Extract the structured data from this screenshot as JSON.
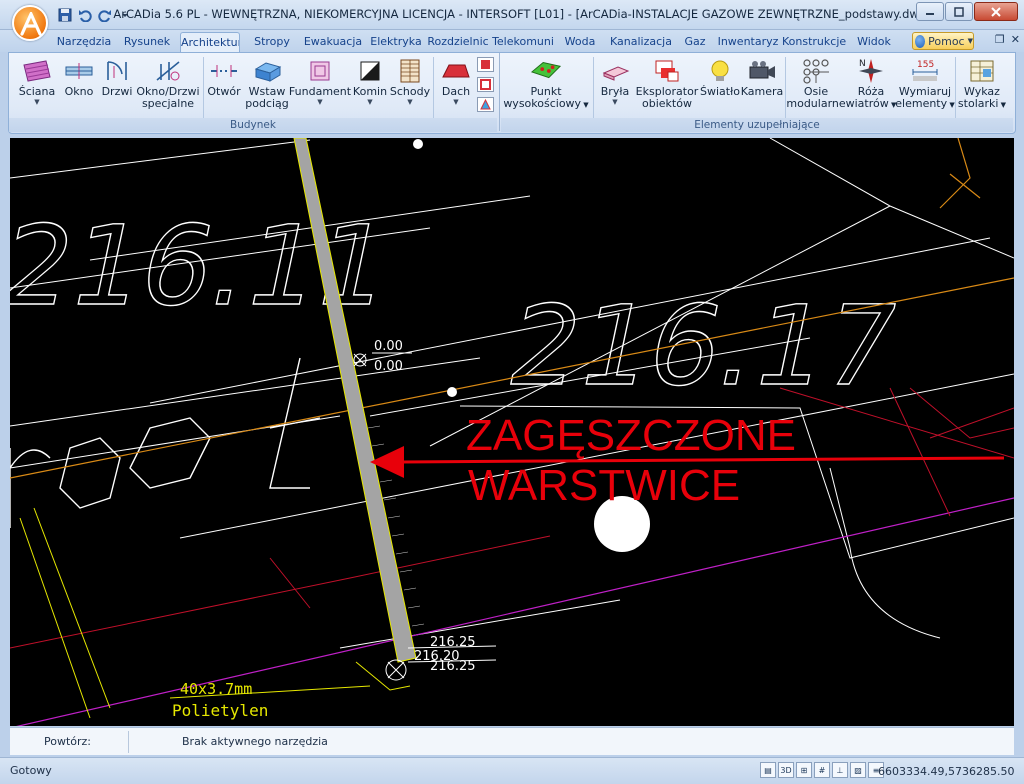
{
  "window": {
    "title": "ArCADia 5.6 PL - WEWNĘTRZNA, NIEKOMERCYJNA LICENCJA - INTERSOFT [L01] - [ArCADia-INSTALACJE GAZOWE ZEWNĘTRZNE_podstawy.dwg]"
  },
  "qat": {
    "save_icon": "save-icon",
    "undo_icon": "undo-icon",
    "redo_icon": "redo-icon"
  },
  "tabs": [
    {
      "label": "Narzędzia g"
    },
    {
      "label": "Rysunek"
    },
    {
      "label": "Architektura"
    },
    {
      "label": "Stropy"
    },
    {
      "label": "Ewakuacja"
    },
    {
      "label": "Elektryka"
    },
    {
      "label": "Rozdzielnic"
    },
    {
      "label": "Telekomuni"
    },
    {
      "label": "Woda"
    },
    {
      "label": "Kanalizacja"
    },
    {
      "label": "Gaz"
    },
    {
      "label": "Inwentaryz"
    },
    {
      "label": "Konstrukcje"
    },
    {
      "label": "Widok"
    }
  ],
  "help": {
    "label": "Pomoc"
  },
  "ribbon": {
    "groups": [
      {
        "label": "Budynek"
      },
      {
        "label": "Elementy uzupełniające"
      }
    ],
    "buttons": [
      {
        "label": "Ściana"
      },
      {
        "label": "Okno"
      },
      {
        "label": "Drzwi"
      },
      {
        "label": "Okno/Drzwi",
        "label2": "specjalne"
      },
      {
        "label": "Otwór"
      },
      {
        "label": "Wstaw",
        "label2": "podciąg"
      },
      {
        "label": "Fundament"
      },
      {
        "label": "Komin"
      },
      {
        "label": "Schody"
      },
      {
        "label": "Dach"
      },
      {
        "label": "Punkt",
        "label2": "wysokościowy"
      },
      {
        "label": "Bryła"
      },
      {
        "label": "Eksplorator",
        "label2": "obiektów"
      },
      {
        "label": "Światło"
      },
      {
        "label": "Kamera"
      },
      {
        "label": "Osie",
        "label2": "modularne"
      },
      {
        "label": "Róża",
        "label2": "wiatrów"
      },
      {
        "label": "Wymiaruj",
        "label2": "elementy"
      },
      {
        "label": "Wykaz",
        "label2": "stolarki"
      }
    ],
    "dimension_badge": "155"
  },
  "drawing": {
    "contour_label_1": "216.11",
    "contour_label_2": "216.17",
    "level_top": "0.00",
    "level_bottom": "0.00",
    "annotation_line1": "ZAGĘSZCZONE",
    "annotation_line2": "WARSTWICE",
    "pipe_spec": "40x3.7mm",
    "pipe_material": "Polietylen",
    "pipe_level_1": "216.25",
    "pipe_level_2": "216.20",
    "pipe_level_3": "216.25",
    "compass_letter": "N",
    "colors": {
      "annotation": "#e8000a",
      "contour_white": "#ffffff",
      "contour_yellow": "#e6e800",
      "contour_orange": "#d98a16",
      "contour_magenta": "#c020c8",
      "contour_red": "#c0102a"
    }
  },
  "command": {
    "label": "Powtórz:",
    "status": "Brak aktywnego narzędzia"
  },
  "statusbar": {
    "text": "Gotowy",
    "coords": "6603334.49,5736285.50",
    "mode_3d": "3D"
  }
}
